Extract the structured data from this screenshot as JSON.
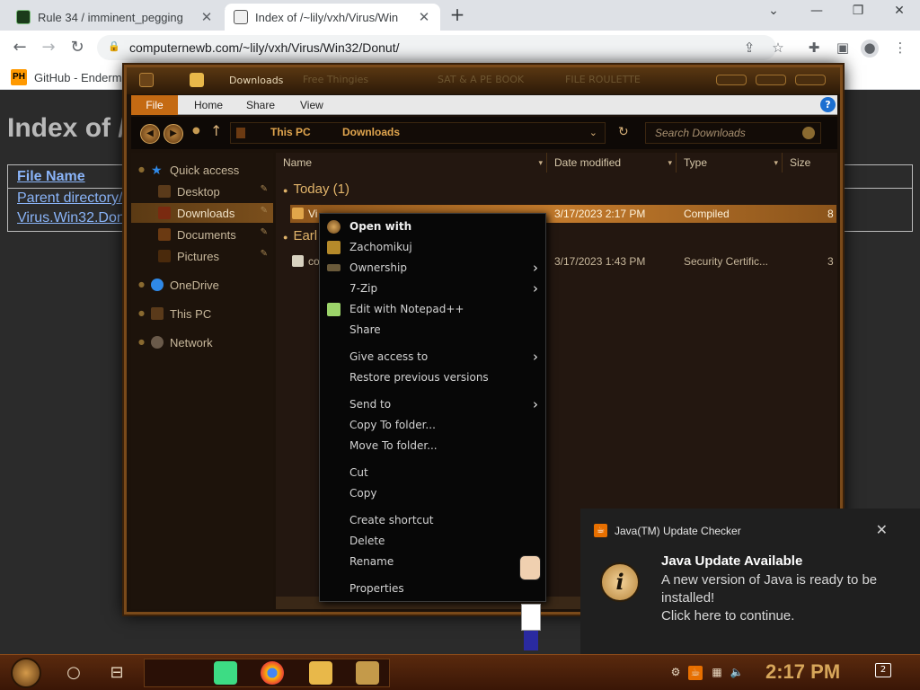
{
  "browser": {
    "tabs": [
      {
        "title": "Rule 34 / imminent_pegging",
        "close": "✕"
      },
      {
        "title": "Index of /~lily/vxh/Virus/Win",
        "close": "✕"
      }
    ],
    "new_tab": "+",
    "url": "computernewb.com/~lily/vxh/Virus/Win32/Donut/",
    "bookmark": {
      "icon_text": "PH",
      "label": "GitHub - Endermo"
    }
  },
  "webpage": {
    "title": "Index of /~lily/vxh/Virus/Win32/Donut/",
    "column_header": "File Name",
    "rows": [
      "Parent directory/",
      "Virus.Win32.Donut"
    ]
  },
  "explorer": {
    "title": "Downloads",
    "ghost_tabs": [
      "Free Thingies",
      "SAT & A PE BOOK",
      "FILE ROULETTE"
    ],
    "ribbon_tabs": [
      "File",
      "Home",
      "Share",
      "View"
    ],
    "breadcrumbs": [
      "This PC",
      "Downloads"
    ],
    "search_placeholder": "Search Downloads",
    "nav": {
      "quick_access": "Quick access",
      "desktop": "Desktop",
      "downloads": "Downloads",
      "documents": "Documents",
      "pictures": "Pictures",
      "onedrive": "OneDrive",
      "this_pc": "This PC",
      "network": "Network"
    },
    "columns": [
      "Name",
      "Date modified",
      "Type",
      "Size"
    ],
    "groups": {
      "today": "Today (1)",
      "earlier": "Earl"
    },
    "files": [
      {
        "name": "Vi",
        "date": "3/17/2023 2:17 PM",
        "type": "Compiled",
        "size": "8",
        "selected": true
      },
      {
        "name": "co",
        "date": "3/17/2023 1:43 PM",
        "type": "Security Certific...",
        "size": "3",
        "selected": false
      }
    ]
  },
  "context_menu": {
    "items": [
      {
        "label": "Open with",
        "icon": "gear-icon",
        "bold": true,
        "arrow": false
      },
      {
        "label": "Zachomikuj",
        "icon": "hamster-icon",
        "bold": false,
        "arrow": false
      },
      {
        "label": "Ownership",
        "icon": "ownership-icon",
        "bold": false,
        "arrow": true
      },
      {
        "label": "7-Zip",
        "icon": "",
        "bold": false,
        "arrow": true
      },
      {
        "label": "Edit with Notepad++",
        "icon": "notepad-icon",
        "bold": false,
        "arrow": false
      },
      {
        "label": "Share",
        "icon": "",
        "bold": false,
        "arrow": false
      },
      {
        "label": "Give access to",
        "icon": "",
        "bold": false,
        "arrow": true
      },
      {
        "label": "Restore previous versions",
        "icon": "",
        "bold": false,
        "arrow": false
      },
      {
        "label": "Send to",
        "icon": "",
        "bold": false,
        "arrow": true
      },
      {
        "label": "Copy To folder...",
        "icon": "",
        "bold": false,
        "arrow": false
      },
      {
        "label": "Move To folder...",
        "icon": "",
        "bold": false,
        "arrow": false
      },
      {
        "label": "Cut",
        "icon": "",
        "bold": false,
        "arrow": false
      },
      {
        "label": "Copy",
        "icon": "",
        "bold": false,
        "arrow": false
      },
      {
        "label": "Create shortcut",
        "icon": "",
        "bold": false,
        "arrow": false
      },
      {
        "label": "Delete",
        "icon": "",
        "bold": false,
        "arrow": false
      },
      {
        "label": "Rename",
        "icon": "",
        "bold": false,
        "arrow": false
      },
      {
        "label": "Properties",
        "icon": "",
        "bold": false,
        "arrow": false
      }
    ]
  },
  "toast": {
    "app_name": "Java(TM) Update Checker",
    "heading": "Java Update Available",
    "body_line1": "A new version of Java is ready to be installed!",
    "body_line2": "Click here to continue.",
    "close": "✕",
    "icon_letter": "i"
  },
  "taskbar": {
    "clock": "2:17 PM",
    "notification_count": "2"
  },
  "colors": {
    "accent_copper": "#c46a13",
    "toast_bg": "#1f1f1f",
    "java_orange": "#e76f00",
    "link_blue": "#8ab4f8"
  }
}
